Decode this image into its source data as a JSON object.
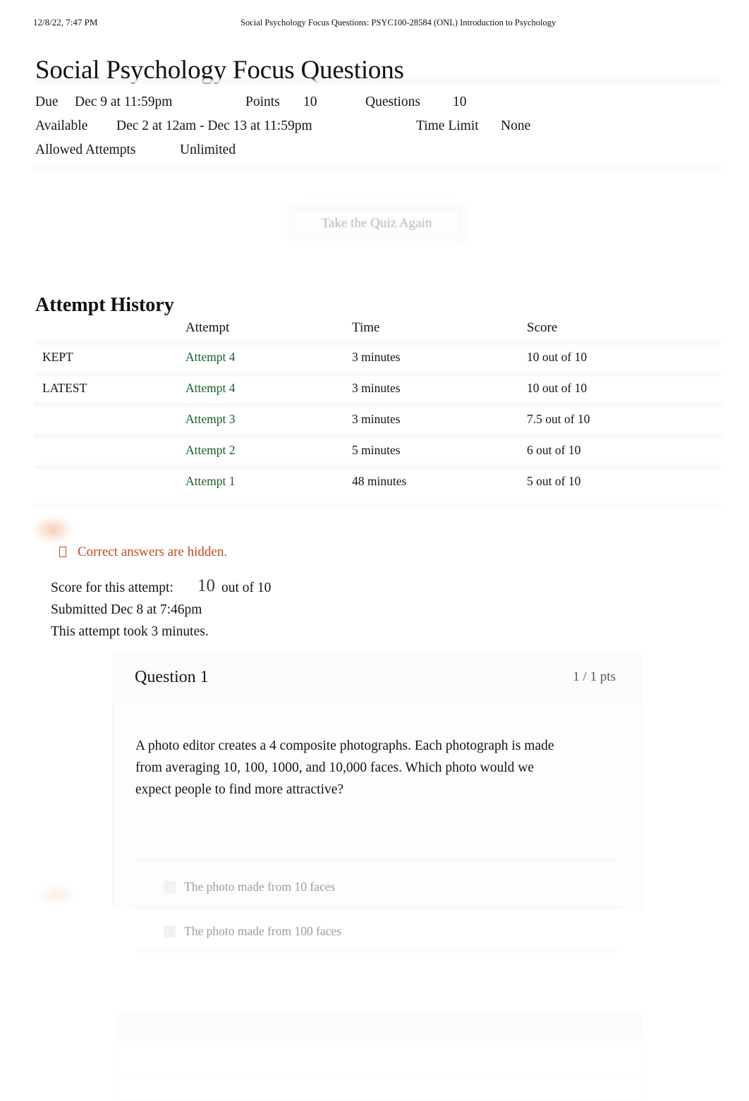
{
  "print_header": {
    "date": "12/8/22, 7:47 PM",
    "title": "Social Psychology Focus Questions: PSYC100-28584 (ONL) Introduction to Psychology"
  },
  "page_title": "Social Psychology Focus Questions",
  "quiz_meta": {
    "due_label": "Due",
    "due_value": "Dec 9 at 11:59pm",
    "points_label": "Points",
    "points_value": "10",
    "questions_label": "Questions",
    "questions_value": "10",
    "available_label": "Available",
    "available_value": "Dec 2 at 12am - Dec 13 at 11:59pm",
    "time_limit_label": "Time Limit",
    "time_limit_value": "None",
    "allowed_attempts_label": "Allowed Attempts",
    "allowed_attempts_value": "Unlimited"
  },
  "retake_button": {
    "label": "Take the Quiz Again"
  },
  "attempt_history": {
    "heading": "Attempt History",
    "columns": {
      "flag": "",
      "attempt": "Attempt",
      "time": "Time",
      "score": "Score"
    },
    "rows": [
      {
        "flag": "KEPT",
        "attempt": "Attempt 4",
        "time": "3 minutes",
        "score": "10 out of 10"
      },
      {
        "flag": "LATEST",
        "attempt": "Attempt 4",
        "time": "3 minutes",
        "score": "10 out of 10"
      },
      {
        "flag": "",
        "attempt": "Attempt 3",
        "time": "3 minutes",
        "score": "7.5 out of 10"
      },
      {
        "flag": "",
        "attempt": "Attempt 2",
        "time": "5 minutes",
        "score": "6 out of 10"
      },
      {
        "flag": "",
        "attempt": "Attempt 1",
        "time": "48 minutes",
        "score": "5 out of 10"
      }
    ]
  },
  "notice": {
    "icon": "warning-icon",
    "text": "Correct answers are hidden."
  },
  "attempt_summary": {
    "score_label": "Score for this attempt:",
    "score_value": "10",
    "score_out_of": "out of 10",
    "submitted": "Submitted Dec 8 at 7:46pm",
    "duration": "This attempt took 3 minutes."
  },
  "question": {
    "name": "Question 1",
    "points": "1 / 1 pts",
    "text": "A photo editor creates a 4 composite photographs. Each photograph is made from averaging 10, 100, 1000, and 10,000 faces. Which photo would we expect people to find more attractive?",
    "answers": [
      {
        "label": "The photo made from 10 faces"
      },
      {
        "label": "The photo made from 100 faces"
      }
    ]
  },
  "colors": {
    "link_green": "#1b5e2a",
    "notice_orange": "#c14a1c",
    "text": "#141414",
    "muted": "#9d9d9f"
  }
}
